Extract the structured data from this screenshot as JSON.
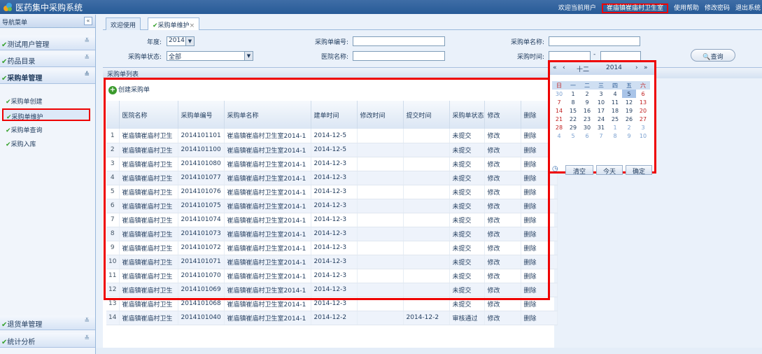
{
  "app": {
    "title": "医药集中采购系统"
  },
  "topbar": {
    "welcome": "欢迎当前用户",
    "user": "崔庙镇崔庙村卫生室",
    "links": [
      "使用帮助",
      "修改密码",
      "退出系统"
    ]
  },
  "sidebar": {
    "title": "导航菜单",
    "collapse_icon": "«",
    "groups": [
      {
        "label": "测试用户管理"
      },
      {
        "label": "药品目录"
      },
      {
        "label": "采购单管理"
      },
      {
        "label": "退货单管理"
      },
      {
        "label": "统计分析"
      }
    ],
    "sub_items": [
      {
        "label": "采购单创建"
      },
      {
        "label": "采购单维护"
      },
      {
        "label": "采购单查询"
      },
      {
        "label": "采购入库"
      }
    ]
  },
  "tabs": [
    {
      "label": "欢迎使用"
    },
    {
      "label": "采购单维护",
      "close": "×"
    }
  ],
  "form": {
    "year_label": "年度:",
    "year_value": "2014",
    "order_no_label": "采购单编号:",
    "order_name_label": "采购单名称:",
    "status_label": "采购单状态:",
    "status_value": "全部",
    "hospital_label": "医院名称:",
    "time_label": "采购时间:",
    "time_sep": "-",
    "query_button": "查询"
  },
  "list": {
    "header": "采购单列表",
    "create_button": "创建采购单",
    "columns": [
      "",
      "医院名称",
      "采购单编号",
      "采购单名称",
      "建单时间",
      "修改时间",
      "提交时间",
      "采购单状态",
      "修改",
      "删除"
    ],
    "rows": [
      [
        "1",
        "崔庙镇崔庙村卫生",
        "2014101101",
        "崔庙镇崔庙村卫生室2014-1",
        "2014-12-5",
        "",
        "",
        "未提交",
        "修改",
        "删除"
      ],
      [
        "2",
        "崔庙镇崔庙村卫生",
        "2014101100",
        "崔庙镇崔庙村卫生室2014-1",
        "2014-12-5",
        "",
        "",
        "未提交",
        "修改",
        "删除"
      ],
      [
        "3",
        "崔庙镇崔庙村卫生",
        "2014101080",
        "崔庙镇崔庙村卫生室2014-1",
        "2014-12-3",
        "",
        "",
        "未提交",
        "修改",
        "删除"
      ],
      [
        "4",
        "崔庙镇崔庙村卫生",
        "2014101077",
        "崔庙镇崔庙村卫生室2014-1",
        "2014-12-3",
        "",
        "",
        "未提交",
        "修改",
        "删除"
      ],
      [
        "5",
        "崔庙镇崔庙村卫生",
        "2014101076",
        "崔庙镇崔庙村卫生室2014-1",
        "2014-12-3",
        "",
        "",
        "未提交",
        "修改",
        "删除"
      ],
      [
        "6",
        "崔庙镇崔庙村卫生",
        "2014101075",
        "崔庙镇崔庙村卫生室2014-1",
        "2014-12-3",
        "",
        "",
        "未提交",
        "修改",
        "删除"
      ],
      [
        "7",
        "崔庙镇崔庙村卫生",
        "2014101074",
        "崔庙镇崔庙村卫生室2014-1",
        "2014-12-3",
        "",
        "",
        "未提交",
        "修改",
        "删除"
      ],
      [
        "8",
        "崔庙镇崔庙村卫生",
        "2014101073",
        "崔庙镇崔庙村卫生室2014-1",
        "2014-12-3",
        "",
        "",
        "未提交",
        "修改",
        "删除"
      ],
      [
        "9",
        "崔庙镇崔庙村卫生",
        "2014101072",
        "崔庙镇崔庙村卫生室2014-1",
        "2014-12-3",
        "",
        "",
        "未提交",
        "修改",
        "删除"
      ],
      [
        "10",
        "崔庙镇崔庙村卫生",
        "2014101071",
        "崔庙镇崔庙村卫生室2014-1",
        "2014-12-3",
        "",
        "",
        "未提交",
        "修改",
        "删除"
      ],
      [
        "11",
        "崔庙镇崔庙村卫生",
        "2014101070",
        "崔庙镇崔庙村卫生室2014-1",
        "2014-12-3",
        "",
        "",
        "未提交",
        "修改",
        "删除"
      ],
      [
        "12",
        "崔庙镇崔庙村卫生",
        "2014101069",
        "崔庙镇崔庙村卫生室2014-1",
        "2014-12-3",
        "",
        "",
        "未提交",
        "修改",
        "删除"
      ],
      [
        "13",
        "崔庙镇崔庙村卫生",
        "2014101068",
        "崔庙镇崔庙村卫生室2014-1",
        "2014-12-3",
        "",
        "",
        "未提交",
        "修改",
        "删除"
      ],
      [
        "14",
        "崔庙镇崔庙村卫生",
        "2014101040",
        "崔庙镇崔庙村卫生室2014-1",
        "2014-12-2",
        "",
        "2014-12-2",
        "审核通过",
        "修改",
        "删除"
      ]
    ]
  },
  "calendar": {
    "month": "十二",
    "year": "2014",
    "nav": [
      "«",
      "‹",
      "›",
      "»"
    ],
    "weekdays": [
      "日",
      "一",
      "二",
      "三",
      "四",
      "五",
      "六"
    ],
    "weeks": [
      [
        "30",
        "1",
        "2",
        "3",
        "4",
        "5",
        "6"
      ],
      [
        "7",
        "8",
        "9",
        "10",
        "11",
        "12",
        "13"
      ],
      [
        "14",
        "15",
        "16",
        "17",
        "18",
        "19",
        "20"
      ],
      [
        "21",
        "22",
        "23",
        "24",
        "25",
        "26",
        "27"
      ],
      [
        "28",
        "29",
        "30",
        "31",
        "1",
        "2",
        "3"
      ],
      [
        "4",
        "5",
        "6",
        "7",
        "8",
        "9",
        "10"
      ]
    ],
    "clear": "清空",
    "today": "今天",
    "ok": "确定"
  },
  "colors": {
    "highlight": "#e00000",
    "header_blue": "#2d609c"
  }
}
